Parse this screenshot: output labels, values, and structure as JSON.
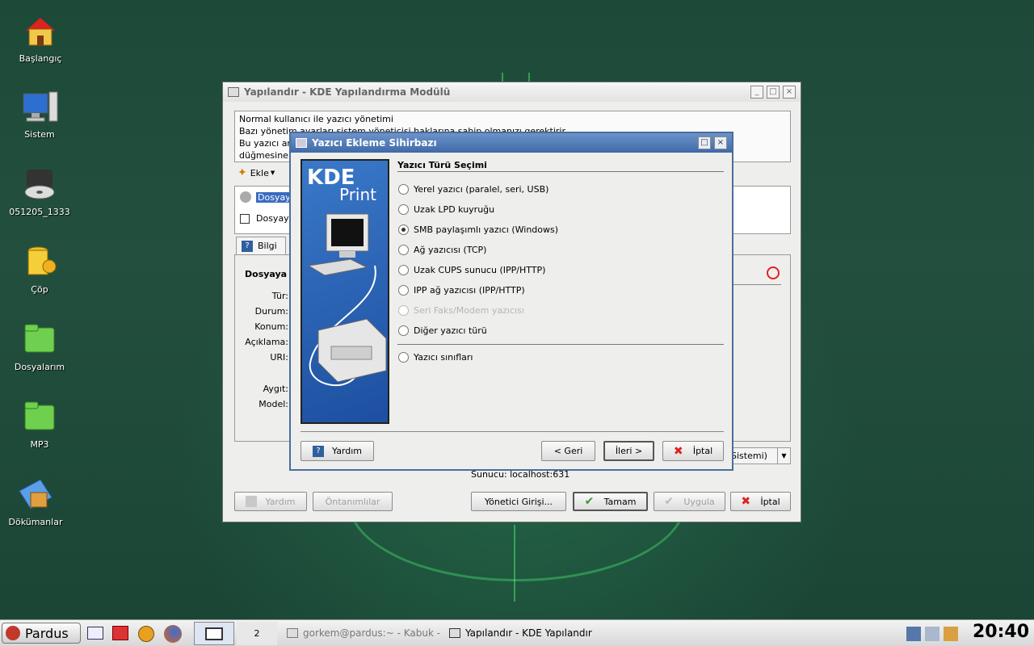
{
  "desktop": {
    "icons": [
      {
        "label": "Başlangıç",
        "icon": "home-icon"
      },
      {
        "label": "Sistem",
        "icon": "computer-icon"
      },
      {
        "label": "051205_1333",
        "icon": "disc-drive-icon"
      },
      {
        "label": "Çöp",
        "icon": "trash-icon"
      },
      {
        "label": "Dosyalarım",
        "icon": "folder-icon"
      },
      {
        "label": "MP3",
        "icon": "folder-icon"
      },
      {
        "label": "Dökümanlar",
        "icon": "documents-icon"
      }
    ]
  },
  "main_window": {
    "title": "Yapılandır - KDE Yapılandırma Modülü",
    "info_lines": [
      "Normal kullanıcı ile yazıcı yönetimi",
      "Bazı yönetim ayarları sistem yöneticisi haklarına sahip olmanızı gerektirir.",
      "Bu yazıcı ar",
      "düğmesine"
    ],
    "toolbar_add": "Ekle",
    "printers": [
      "Dosyaya",
      "Dosyay"
    ],
    "tab_info": "Bilgi",
    "section_title": "Dosyaya",
    "fields": [
      "Tür:",
      "Durum:",
      "Konum:",
      "Açıklama:",
      "URI:",
      "Aygıt:",
      "Model:"
    ],
    "print_system": "Sistemi)",
    "server": "Sunucu: localhost:631",
    "buttons": {
      "help": "Yardım",
      "defaults": "Öntanımlılar",
      "admin": "Yönetici Girişi...",
      "ok": "Tamam",
      "apply": "Uygula",
      "cancel": "İptal"
    }
  },
  "wizard": {
    "title": "Yazıcı Ekleme Sihirbazı",
    "brand_big": "KDE",
    "brand_small": "Print",
    "heading": "Yazıcı Türü Seçimi",
    "options": [
      {
        "label": "Yerel yazıcı (paralel, seri, USB)",
        "state": "normal"
      },
      {
        "label": "Uzak LPD kuyruğu",
        "state": "normal"
      },
      {
        "label": "SMB paylaşımlı yazıcı (Windows)",
        "state": "checked"
      },
      {
        "label": "Ağ yazıcısı (TCP)",
        "state": "normal"
      },
      {
        "label": "Uzak CUPS sunucu (IPP/HTTP)",
        "state": "normal"
      },
      {
        "label": "IPP ağ yazıcısı (IPP/HTTP)",
        "state": "normal"
      },
      {
        "label": "Seri Faks/Modem yazıcısı",
        "state": "disabled"
      },
      {
        "label": "Diğer yazıcı türü",
        "state": "normal"
      }
    ],
    "class_option": "Yazıcı sınıfları",
    "buttons": {
      "help": "Yardım",
      "back": "< Geri",
      "next": "İleri >",
      "cancel": "İptal"
    }
  },
  "taskbar": {
    "start_label": "Pardus",
    "desktop_number": "2",
    "tasks": [
      "gorkem@pardus:~ - Kabuk - K",
      "Yapılandır - KDE Yapılandır"
    ],
    "clock": "20:40"
  }
}
